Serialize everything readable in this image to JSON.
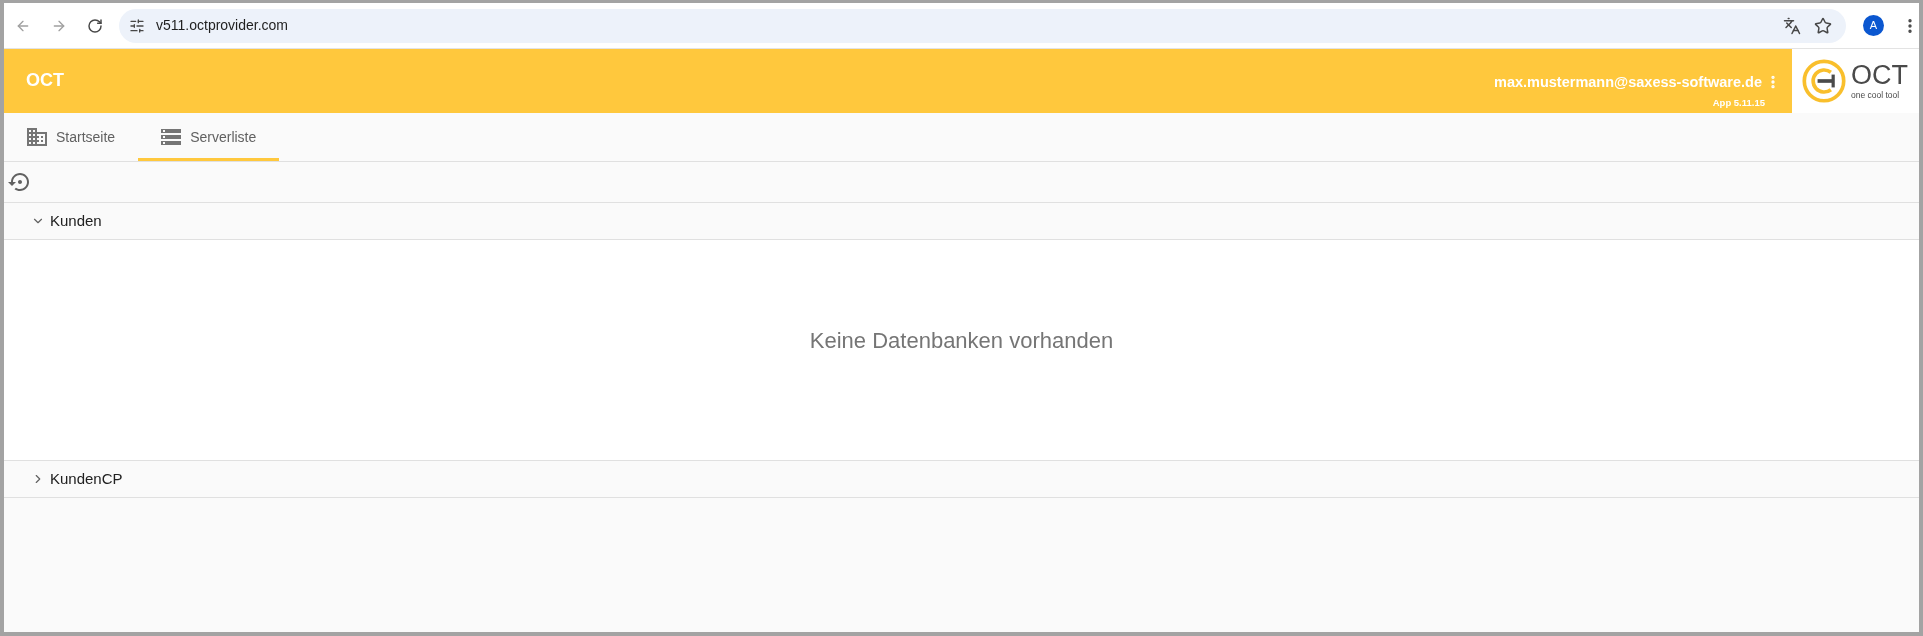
{
  "browser": {
    "url": "v511.octprovider.com",
    "profile_initial": "A"
  },
  "header": {
    "title": "OCT",
    "user_email": "max.mustermann@saxess-software.de",
    "app_version": "App 5.11.15",
    "logo": {
      "wordmark": "OCT",
      "tagline": "one cool tool"
    }
  },
  "tabs": [
    {
      "label": "Startseite",
      "kind": "building",
      "selected": false
    },
    {
      "label": "Serverliste",
      "kind": "servers",
      "selected": true
    }
  ],
  "groups": [
    {
      "name": "Kunden",
      "expanded": true,
      "empty_message": "Keine Datenbanken vorhanden"
    },
    {
      "name": "KundenCP",
      "expanded": false
    }
  ]
}
